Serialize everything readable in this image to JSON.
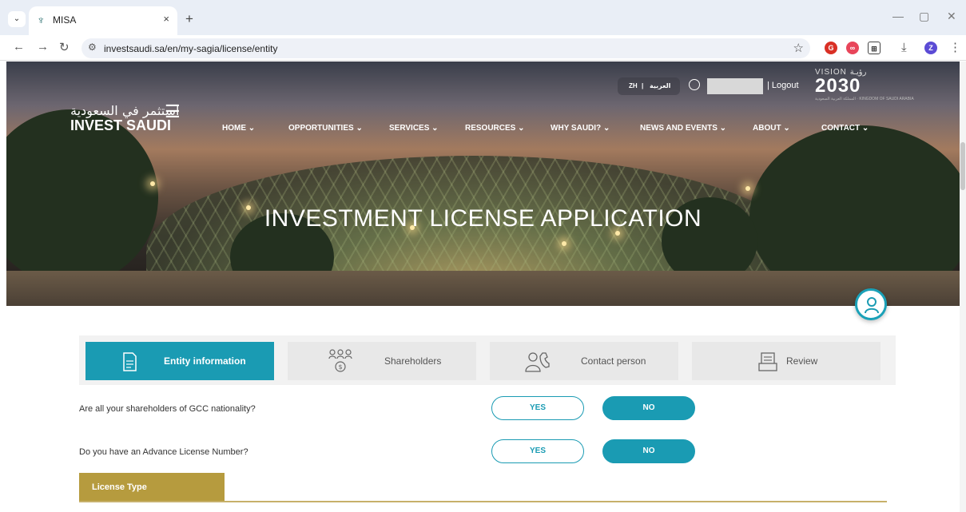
{
  "browser": {
    "tab_title": "MISA",
    "url": "investsaudi.sa/en/my-sagia/license/entity",
    "tab_dropdown": "⌄",
    "new_tab": "+",
    "tab_close": "×"
  },
  "header": {
    "logo_arabic": "استثمر في السعودية",
    "logo_english": "INVEST SAUDI",
    "lang_zh": "ZH",
    "lang_ar": "العربية",
    "logout": "Logout",
    "vision_label": "VISION رؤيـة",
    "vision_number": "2030",
    "vision_sub": "المملكة العربية السعودية · KINGDOM OF SAUDI ARABIA",
    "nav": [
      {
        "label": "HOME"
      },
      {
        "label": "OPPORTUNITIES"
      },
      {
        "label": "SERVICES"
      },
      {
        "label": "RESOURCES"
      },
      {
        "label": "WHY SAUDI?"
      },
      {
        "label": "NEWS AND EVENTS"
      },
      {
        "label": "ABOUT"
      },
      {
        "label": "CONTACT"
      }
    ]
  },
  "hero": {
    "title": "INVESTMENT LICENSE APPLICATION"
  },
  "steps": [
    {
      "label": "Entity information",
      "icon": "document-icon",
      "active": true
    },
    {
      "label": "Shareholders",
      "icon": "shareholders-icon",
      "active": false
    },
    {
      "label": "Contact person",
      "icon": "contact-person-icon",
      "active": false
    },
    {
      "label": "Review",
      "icon": "review-icon",
      "active": false
    }
  ],
  "questions": [
    {
      "text": "Are all your shareholders of GCC nationality?",
      "yes": "YES",
      "no": "NO",
      "selected": "NO"
    },
    {
      "text": "Do you have an Advance License Number?",
      "yes": "YES",
      "no": "NO",
      "selected": "NO"
    }
  ],
  "license_type": {
    "label": "License Type"
  },
  "colors": {
    "teal": "#1a9bb3",
    "gold": "#b69b3e"
  }
}
